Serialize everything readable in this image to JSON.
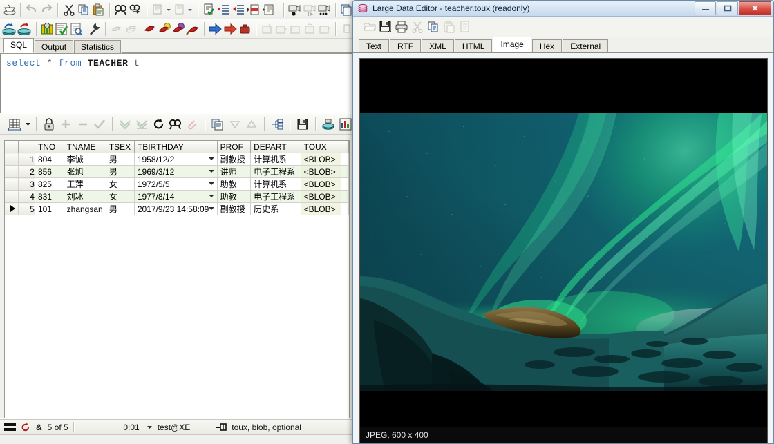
{
  "left_app": {
    "tabs": [
      {
        "label": "SQL",
        "active": true
      },
      {
        "label": "Output",
        "active": false
      },
      {
        "label": "Statistics",
        "active": false
      }
    ],
    "sql": {
      "kw_select": "select",
      "star": "*",
      "kw_from": "from",
      "table": "TEACHER",
      "alias": "t"
    },
    "grid": {
      "columns": [
        "TNO",
        "TNAME",
        "TSEX",
        "TBIRTHDAY",
        "PROF",
        "DEPART",
        "TOUX"
      ],
      "rows": [
        {
          "n": "1",
          "marked": false,
          "TNO": "804",
          "TNAME": "李诚",
          "TSEX": "男",
          "TBIRTHDAY": "1958/12/2",
          "PROF": "副教授",
          "DEPART": "计算机系",
          "TOUX": "<BLOB>"
        },
        {
          "n": "2",
          "marked": false,
          "TNO": "856",
          "TNAME": "张旭",
          "TSEX": "男",
          "TBIRTHDAY": "1969/3/12",
          "PROF": "讲师",
          "DEPART": "电子工程系",
          "TOUX": "<BLOB>"
        },
        {
          "n": "3",
          "marked": false,
          "TNO": "825",
          "TNAME": "王萍",
          "TSEX": "女",
          "TBIRTHDAY": "1972/5/5",
          "PROF": "助教",
          "DEPART": "计算机系",
          "TOUX": "<BLOB>"
        },
        {
          "n": "4",
          "marked": false,
          "TNO": "831",
          "TNAME": "刘冰",
          "TSEX": "女",
          "TBIRTHDAY": "1977/8/14",
          "PROF": "助教",
          "DEPART": "电子工程系",
          "TOUX": "<BLOB>"
        },
        {
          "n": "5",
          "marked": true,
          "TNO": "101",
          "TNAME": "zhangsan",
          "TSEX": "男",
          "TBIRTHDAY": "2017/9/23 14:58:09",
          "PROF": "副教授",
          "DEPART": "历史系",
          "TOUX": "<BLOB>"
        }
      ]
    },
    "status": {
      "record_count": "5 of 5",
      "elapsed": "0:01",
      "connection": "test@XE",
      "field_info": "toux, blob, optional"
    }
  },
  "editor_window": {
    "title": "Large Data Editor - teacher.toux (readonly)",
    "window_buttons": {
      "minimize": "–",
      "maximize": "▭",
      "close": "✕"
    },
    "toolbar_icons": [
      "open-icon",
      "save-icon",
      "print-icon",
      "cut-icon",
      "copy-icon",
      "paste-icon",
      "clear-icon"
    ],
    "tabs": [
      {
        "label": "Text",
        "active": false
      },
      {
        "label": "RTF",
        "active": false
      },
      {
        "label": "XML",
        "active": false
      },
      {
        "label": "HTML",
        "active": false
      },
      {
        "label": "Image",
        "active": true
      },
      {
        "label": "Hex",
        "active": false
      },
      {
        "label": "External",
        "active": false
      }
    ],
    "status": "JPEG, 600 x 400",
    "image_description": "aurora borealis over snowy mountains"
  },
  "colors": {
    "aurora_green": "#1fd96b",
    "sky_teal": "#0c3a46",
    "snow_teal": "#1d6b6b",
    "rock_brown": "#6d5a33",
    "accent_blue": "#2f6fb5",
    "close_red": "#c22f26"
  }
}
